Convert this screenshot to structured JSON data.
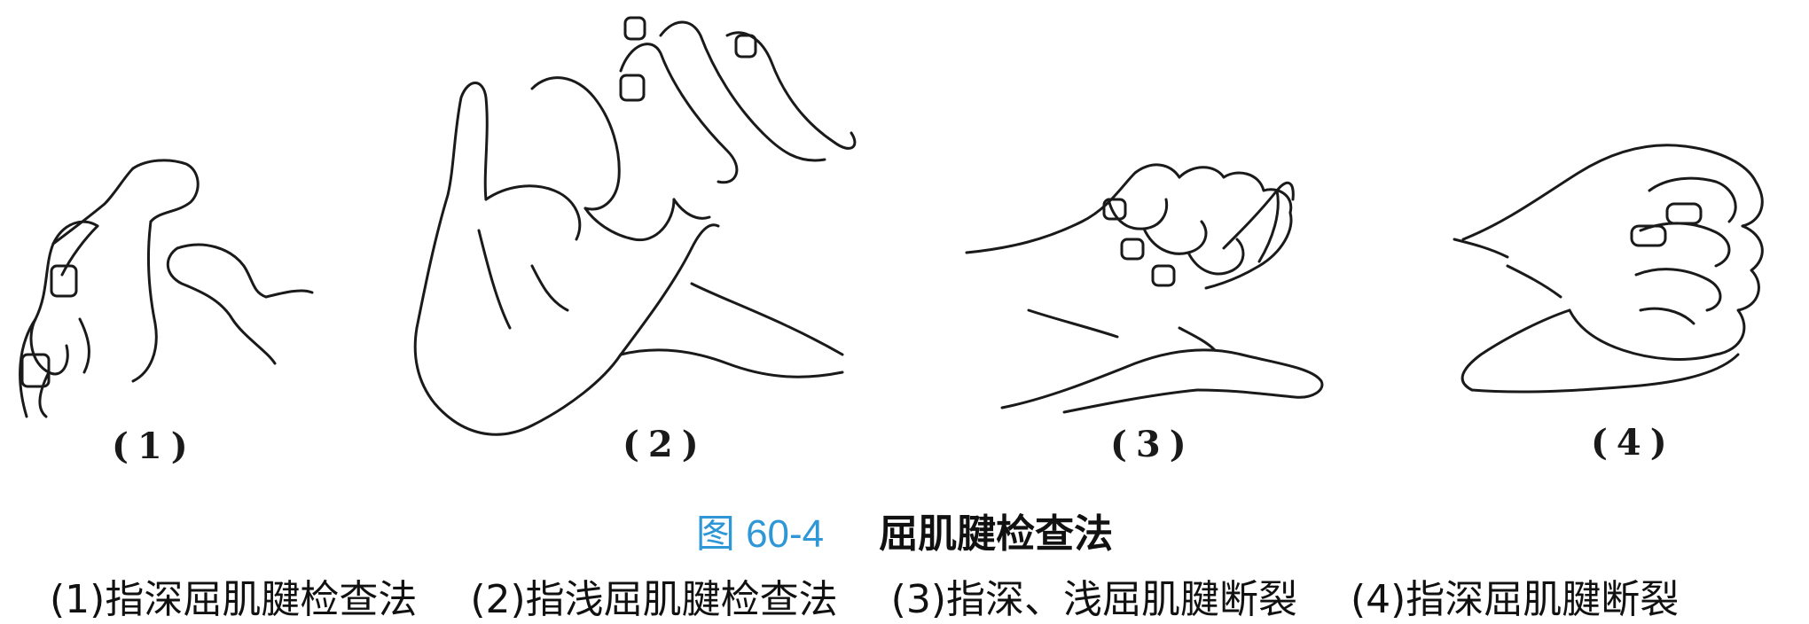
{
  "figure": {
    "number": "图 60-4",
    "title": "屈肌腱检查法",
    "number_color": "#2f97d6"
  },
  "panels": [
    {
      "label": "(1)",
      "caption": "(1)指深屈肌腱检查法"
    },
    {
      "label": "(2)",
      "caption": "(2)指浅屈肌腱检查法"
    },
    {
      "label": "(3)",
      "caption": "(3)指深、浅屈肌腱断裂"
    },
    {
      "label": "(4)",
      "caption": "(4)指深屈肌腱断裂"
    }
  ]
}
